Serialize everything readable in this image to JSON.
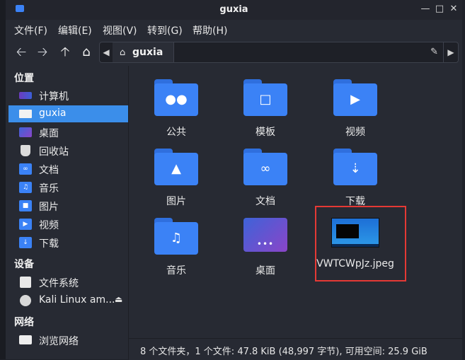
{
  "window": {
    "title": "guxia"
  },
  "menu": [
    "文件(F)",
    "编辑(E)",
    "视图(V)",
    "转到(G)",
    "帮助(H)"
  ],
  "path": {
    "current": "guxia"
  },
  "sidebar": {
    "sections": [
      {
        "title": "位置",
        "items": [
          {
            "label": "计算机"
          },
          {
            "label": "guxia",
            "selected": true
          },
          {
            "label": "桌面"
          },
          {
            "label": "回收站"
          },
          {
            "label": "文档"
          },
          {
            "label": "音乐"
          },
          {
            "label": "图片"
          },
          {
            "label": "视频"
          },
          {
            "label": "下载"
          }
        ]
      },
      {
        "title": "设备",
        "items": [
          {
            "label": "文件系统"
          },
          {
            "label": "Kali Linux am..."
          }
        ]
      },
      {
        "title": "网络",
        "items": [
          {
            "label": "浏览网络"
          }
        ]
      }
    ]
  },
  "files": [
    {
      "name": "公共",
      "icon": "people-folder-icon"
    },
    {
      "name": "模板",
      "icon": "template-folder-icon"
    },
    {
      "name": "视频",
      "icon": "video-folder-icon"
    },
    {
      "name": "图片",
      "icon": "pictures-folder-icon"
    },
    {
      "name": "文档",
      "icon": "documents-folder-icon"
    },
    {
      "name": "下载",
      "icon": "download-folder-icon"
    },
    {
      "name": "音乐",
      "icon": "music-folder-icon"
    },
    {
      "name": "桌面",
      "icon": "desktop-folder-icon"
    },
    {
      "name": "VWTCWpJz.jpeg",
      "icon": "image-thumbnail"
    }
  ],
  "status": {
    "text": "8 个文件夹，1 个文件: 47.8 KiB (48,997 字节), 可用空间: 25.9 GiB"
  },
  "colors": {
    "accent": "#3b8eea",
    "folder": "#3b82f6",
    "highlight": "#e53935"
  }
}
